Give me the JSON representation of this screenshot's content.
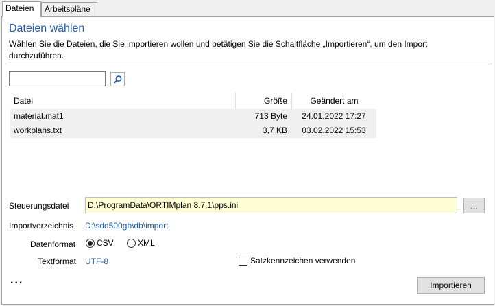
{
  "tabs": [
    {
      "label": "Dateien",
      "active": true
    },
    {
      "label": "Arbeitspläne",
      "active": false
    }
  ],
  "page": {
    "title": "Dateien wählen",
    "description": "Wählen Sie die Dateien, die Sie importieren wollen und betätigen Sie die Schaltfläche „Importieren“, um den Import durchzuführen."
  },
  "search": {
    "value": "",
    "placeholder": "",
    "icon": "search-icon"
  },
  "grid": {
    "columns": [
      "Datei",
      "Größe",
      "Geändert am"
    ],
    "rows": [
      {
        "name": "material.mat1",
        "size": "713 Byte",
        "modified": "24.01.2022 17:27"
      },
      {
        "name": "workplans.txt",
        "size": "3,7 KB",
        "modified": "03.02.2022 15:53"
      }
    ]
  },
  "settings": {
    "control_file_label": "Steuerungsdatei",
    "control_file_value": "D:\\ProgramData\\ORTIMplan 8.7.1\\pps.ini",
    "browse_label": "...",
    "import_dir_label": "Importverzeichnis",
    "import_dir_value": "D:\\sdd500gb\\db\\import",
    "format_label": "Datenformat",
    "format_options": [
      {
        "label": "CSV",
        "checked": true
      },
      {
        "label": "XML",
        "checked": false
      }
    ],
    "text_format_label": "Textformat",
    "text_format_value": "UTF-8",
    "record_marker_label": "Satzkennzeichen verwenden",
    "record_marker_checked": false
  },
  "footer": {
    "more_label": "...",
    "import_label": "Importieren"
  },
  "colors": {
    "accent": "#1e5ba8",
    "input_highlight": "#fefed5"
  }
}
